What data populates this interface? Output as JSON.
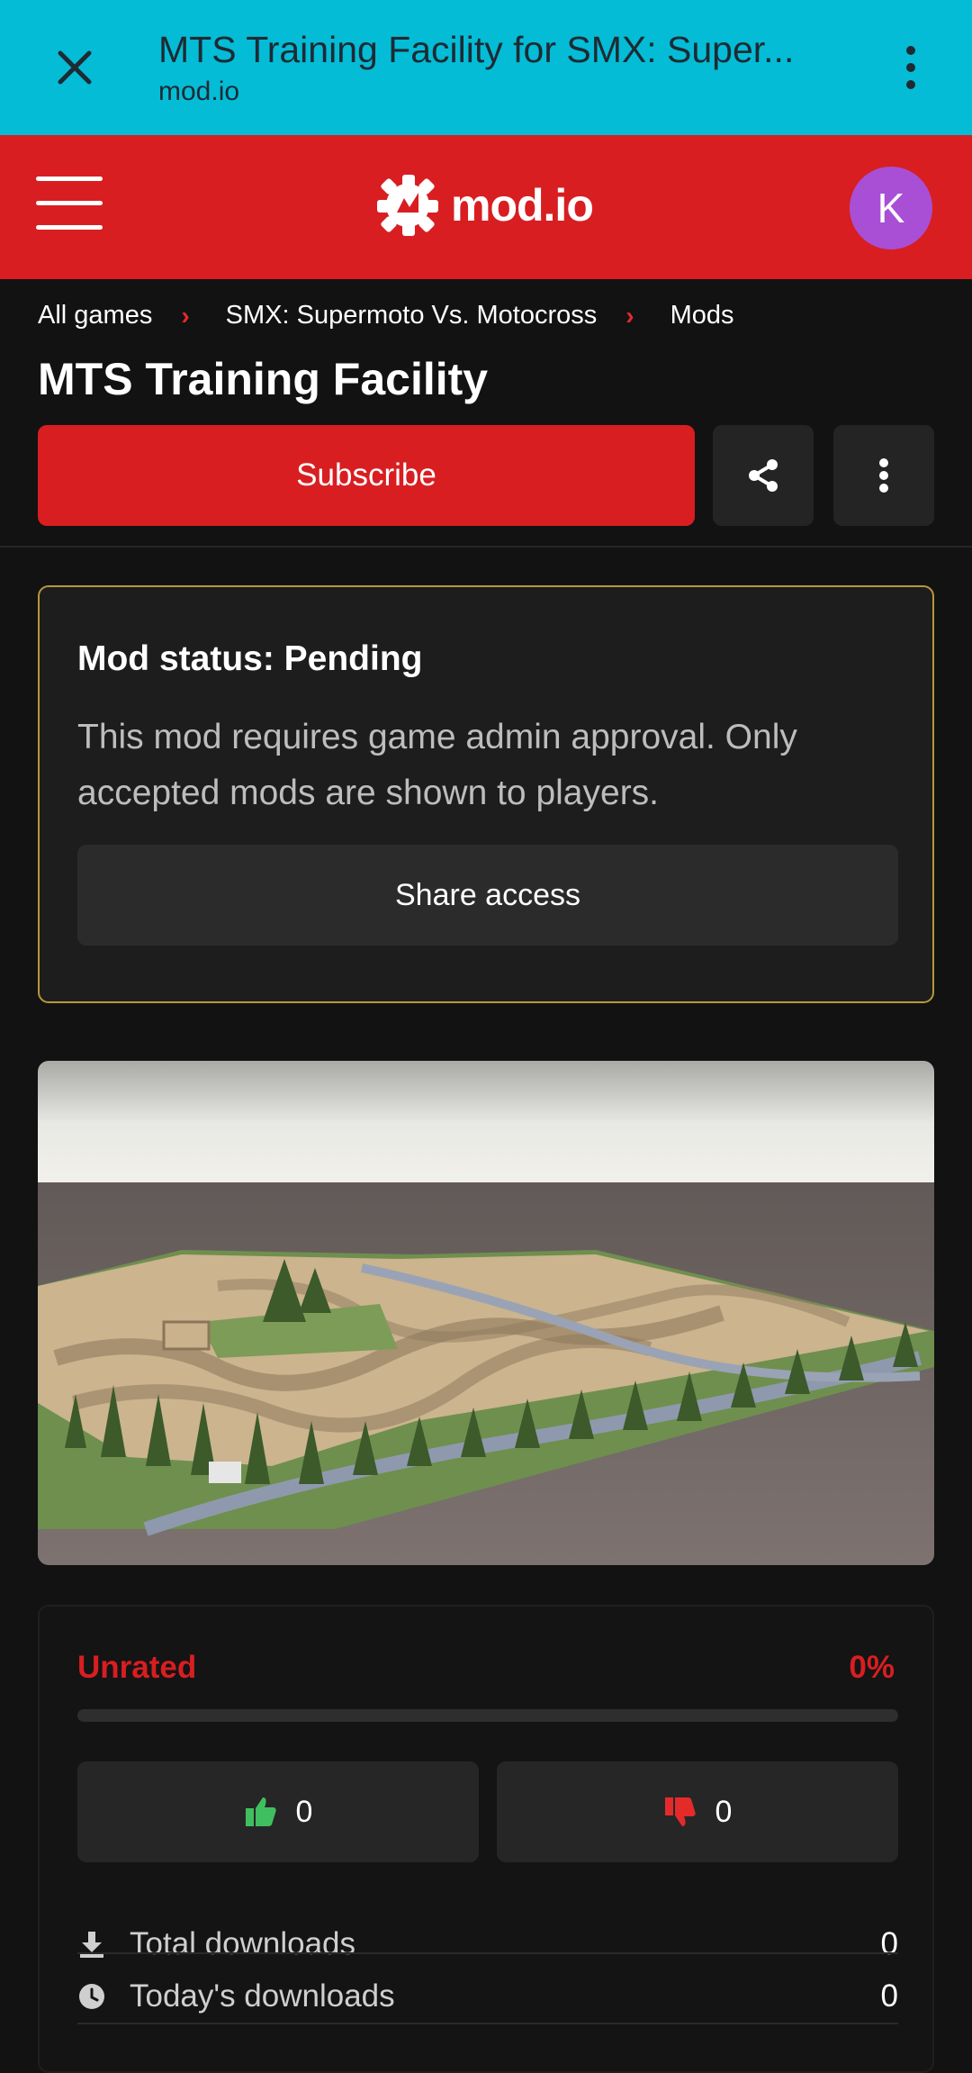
{
  "browser": {
    "title": "MTS Training Facility for SMX: Super...",
    "url": "mod.io"
  },
  "header": {
    "logo_text": "mod.io",
    "avatar_initial": "K"
  },
  "breadcrumb": [
    "All games",
    "SMX: Supermoto Vs. Motocross",
    "Mods"
  ],
  "page": {
    "title": "MTS Training Facility",
    "subscribe_label": "Subscribe"
  },
  "status": {
    "title": "Mod status: Pending",
    "description": "This mod requires game admin approval. Only accepted mods are shown to players.",
    "share_access_label": "Share access"
  },
  "stats": {
    "rating_label": "Unrated",
    "rating_percent": "0%",
    "upvotes": "0",
    "downvotes": "0",
    "rows": [
      {
        "label": "Total downloads",
        "value": "0",
        "icon": "download-icon"
      },
      {
        "label": "Today's downloads",
        "value": "0",
        "icon": "clock-icon"
      }
    ]
  },
  "colors": {
    "browser_bar": "#04bcd6",
    "brand_red": "#d81e21",
    "status_border": "#b8963a",
    "avatar": "#a94fd6",
    "upvote": "#3fbf5f"
  }
}
